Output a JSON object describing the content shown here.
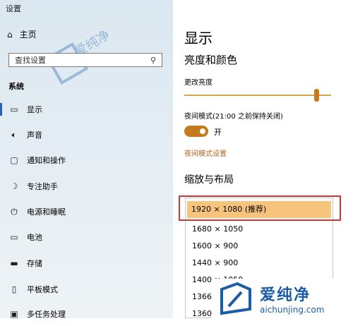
{
  "window": {
    "title": "设置"
  },
  "sidebar": {
    "home_label": "主页",
    "search_placeholder": "查找设置",
    "system_label": "系统",
    "items": [
      {
        "label": "显示",
        "icon": "monitor-icon",
        "active": true
      },
      {
        "label": "声音",
        "icon": "speaker-icon"
      },
      {
        "label": "通知和操作",
        "icon": "notification-icon"
      },
      {
        "label": "专注助手",
        "icon": "moon-icon"
      },
      {
        "label": "电源和睡眠",
        "icon": "power-icon"
      },
      {
        "label": "电池",
        "icon": "battery-icon"
      },
      {
        "label": "存储",
        "icon": "storage-icon"
      },
      {
        "label": "平板模式",
        "icon": "tablet-icon"
      },
      {
        "label": "多任务处理",
        "icon": "multitask-icon"
      }
    ]
  },
  "main": {
    "title": "显示",
    "section_brightness": "亮度和颜色",
    "brightness_label": "更改亮度",
    "brightness_value": 0.9,
    "night_mode_label": "夜间模式(21:00 之前保持关闭)",
    "night_mode_state": "开",
    "night_mode_link": "夜间模式设置",
    "section_scale": "缩放与布局",
    "resolutions": [
      "1920 × 1080 (推荐)",
      "1680 × 1050",
      "1600 × 900",
      "1440 × 900",
      "1400 × 1050",
      "1366 × 768",
      "1360 × 768"
    ]
  },
  "watermark": {
    "brand": "爱纯净",
    "url": "aichunjing.com"
  },
  "colors": {
    "accent": "#c57a1f",
    "selected": "#f7c47e",
    "highlight": "#d73434"
  }
}
